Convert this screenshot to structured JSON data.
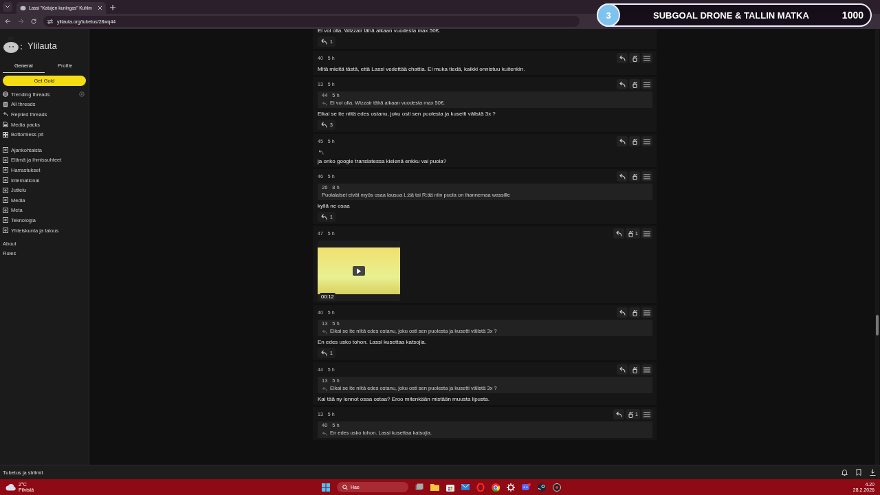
{
  "browser": {
    "tab_title": "Lassi \"Katujen kuningas\" Kuhlm",
    "url": "ylilauta.org/tubetus/28wq44"
  },
  "overlay": {
    "step": "3",
    "title": "SUBGOAL DRONE & TALLIN MATKA",
    "goal": "1000"
  },
  "sidebar": {
    "brand": "Ylilauta",
    "tabs": [
      {
        "label": "General",
        "selected": true
      },
      {
        "label": "Profile",
        "selected": false
      }
    ],
    "gold_button": "Get Gold",
    "nav": [
      {
        "label": "Trending threads",
        "kind": "trending"
      },
      {
        "label": "All threads",
        "kind": "all"
      },
      {
        "label": "Replied threads",
        "kind": "replied"
      },
      {
        "label": "Media packs",
        "kind": "media"
      },
      {
        "label": "Bottomless pit",
        "kind": "pit"
      }
    ],
    "categories": [
      "Ajankohtaista",
      "Elämä ja ihmissuhteet",
      "Harrastukset",
      "International",
      "Juttelu",
      "Media",
      "Meta",
      "Teknologia",
      "Yhteiskunta ja talous"
    ],
    "links": [
      "About",
      "Rules"
    ]
  },
  "posts": [
    {
      "kind": "continued",
      "body": "Ei voi olla. Wizzair tähä aikaan vuodesta max 50€.",
      "replies": "1",
      "backlink": false
    },
    {
      "kind": "full",
      "number": "40",
      "time": "5 h",
      "body": "Mitä mieltä tästä, että Lassi vedettää chattia. Ei muka tiedä, kaikki onnistuu kuitenkin.",
      "backlink": false
    },
    {
      "kind": "full",
      "number": "13",
      "time": "5 h",
      "quote": {
        "number": "44",
        "time": "5 h",
        "text": "Ei voi olla. Wizzair tähä aikaan vuodesta max 50€.",
        "reply_icon": true
      },
      "body": "Eikai se ite niitä edes ostanu, joku osti sen puolesta ja kusetti välistä 3x  ?",
      "replies": "3",
      "backlink": false
    },
    {
      "kind": "full",
      "number": "45",
      "time": "5 h",
      "backlink": true,
      "body": "ja onko google translatessa kielenä enkku vai puola?"
    },
    {
      "kind": "full",
      "number": "46",
      "time": "5 h",
      "quote": {
        "number": "26",
        "time": "8 h",
        "text": "Puolalaiset eivät myös osaa lausua L:ää tai R:ää niin puola on ihannemaa wassille",
        "reply_icon": false
      },
      "body": "kyllä ne osaa",
      "replies": "1",
      "backlink": false
    },
    {
      "kind": "full",
      "number": "47",
      "time": "5 h",
      "likes": "1",
      "media": {
        "kind": "video",
        "duration": "00:12"
      },
      "backlink": false
    },
    {
      "kind": "full",
      "number": "40",
      "time": "5 h",
      "quote": {
        "number": "13",
        "time": "5 h",
        "text": "Eikai se ite niitä edes ostanu, joku osti sen puolesta ja kusetti välistä 3x ?",
        "reply_icon": true
      },
      "body": "En edes usko tohon. Lassi kusettaa katsojia.",
      "replies": "1",
      "backlink": false
    },
    {
      "kind": "full",
      "number": "44",
      "time": "5 h",
      "quote": {
        "number": "13",
        "time": "5 h",
        "text": "Eikai se ite niitä edes ostanu, joku osti sen puolesta ja kusetti välistä 3x ?",
        "reply_icon": true
      },
      "body": "Kai tää ny lennot osaa ostaa? Eroo mitenkään mistään muusta lipusta.",
      "backlink": false
    },
    {
      "kind": "full",
      "number": "13",
      "time": "5 h",
      "likes": "1",
      "quote": {
        "number": "40",
        "time": "5 h",
        "text": "En edes usko tohon. Lassi kusettaa katsojia.",
        "reply_icon": true
      },
      "backlink": false
    }
  ],
  "bottom_bar": {
    "title": "Tubetus ja striimit"
  },
  "taskbar": {
    "temperature": "2°C",
    "weather": "Pilvistä",
    "search_placeholder": "Hae",
    "time": "4.20",
    "date": "28.2.2026"
  }
}
